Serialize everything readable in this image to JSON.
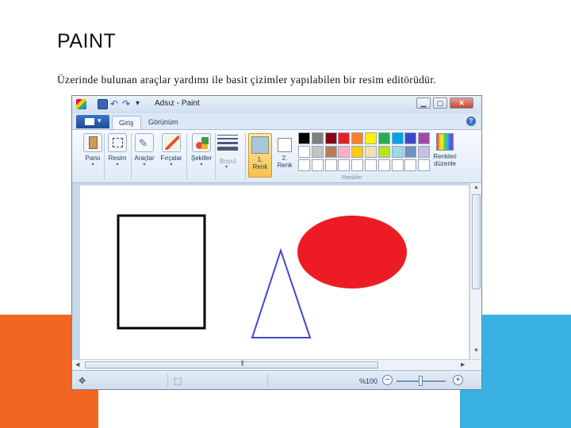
{
  "slide": {
    "title": "PAINT",
    "body": "Üzerinde bulunan araçlar yardımı ile basit çizimler yapılabilen bir resim editörüdür."
  },
  "window": {
    "title": "Adsız - Paint",
    "min_label": "▁",
    "max_label": "▢",
    "close_label": "✕"
  },
  "tabs": {
    "home": "Giriş",
    "view": "Görünüm"
  },
  "ribbon": {
    "clipboard": "Pano",
    "image": "Resim",
    "tools": "Araçlar",
    "brushes": "Fırçalar",
    "shapes": "Şekiller",
    "size": "Boyut",
    "color1_num": "1.",
    "color1": "Renk",
    "color2_num": "2.",
    "color2": "Renk",
    "edit_colors_1": "Renkleri",
    "edit_colors_2": "düzenle",
    "colors_group": "Renkler"
  },
  "palette": {
    "color1": "#a8c8d8",
    "color2": "#ffffff",
    "row1": [
      "#000000",
      "#7f7f7f",
      "#880015",
      "#ed1c24",
      "#ff7f27",
      "#fff200",
      "#22b14c",
      "#00a2e8",
      "#3f48cc",
      "#a349a4"
    ],
    "row2": [
      "#ffffff",
      "#c3c3c3",
      "#b97a57",
      "#ffaec9",
      "#ffc90e",
      "#efe4b0",
      "#b5e61d",
      "#99d9ea",
      "#7092be",
      "#c8bfe7"
    ],
    "row3": [
      "#ffffff",
      "#ffffff",
      "#ffffff",
      "#ffffff",
      "#ffffff",
      "#ffffff",
      "#ffffff",
      "#ffffff",
      "#ffffff",
      "#ffffff"
    ]
  },
  "drawing": {
    "rect_color": "#000000",
    "triangle_color": "#3f48cc",
    "ellipse_color": "#ed1c24"
  },
  "status": {
    "zoom": "%100"
  }
}
